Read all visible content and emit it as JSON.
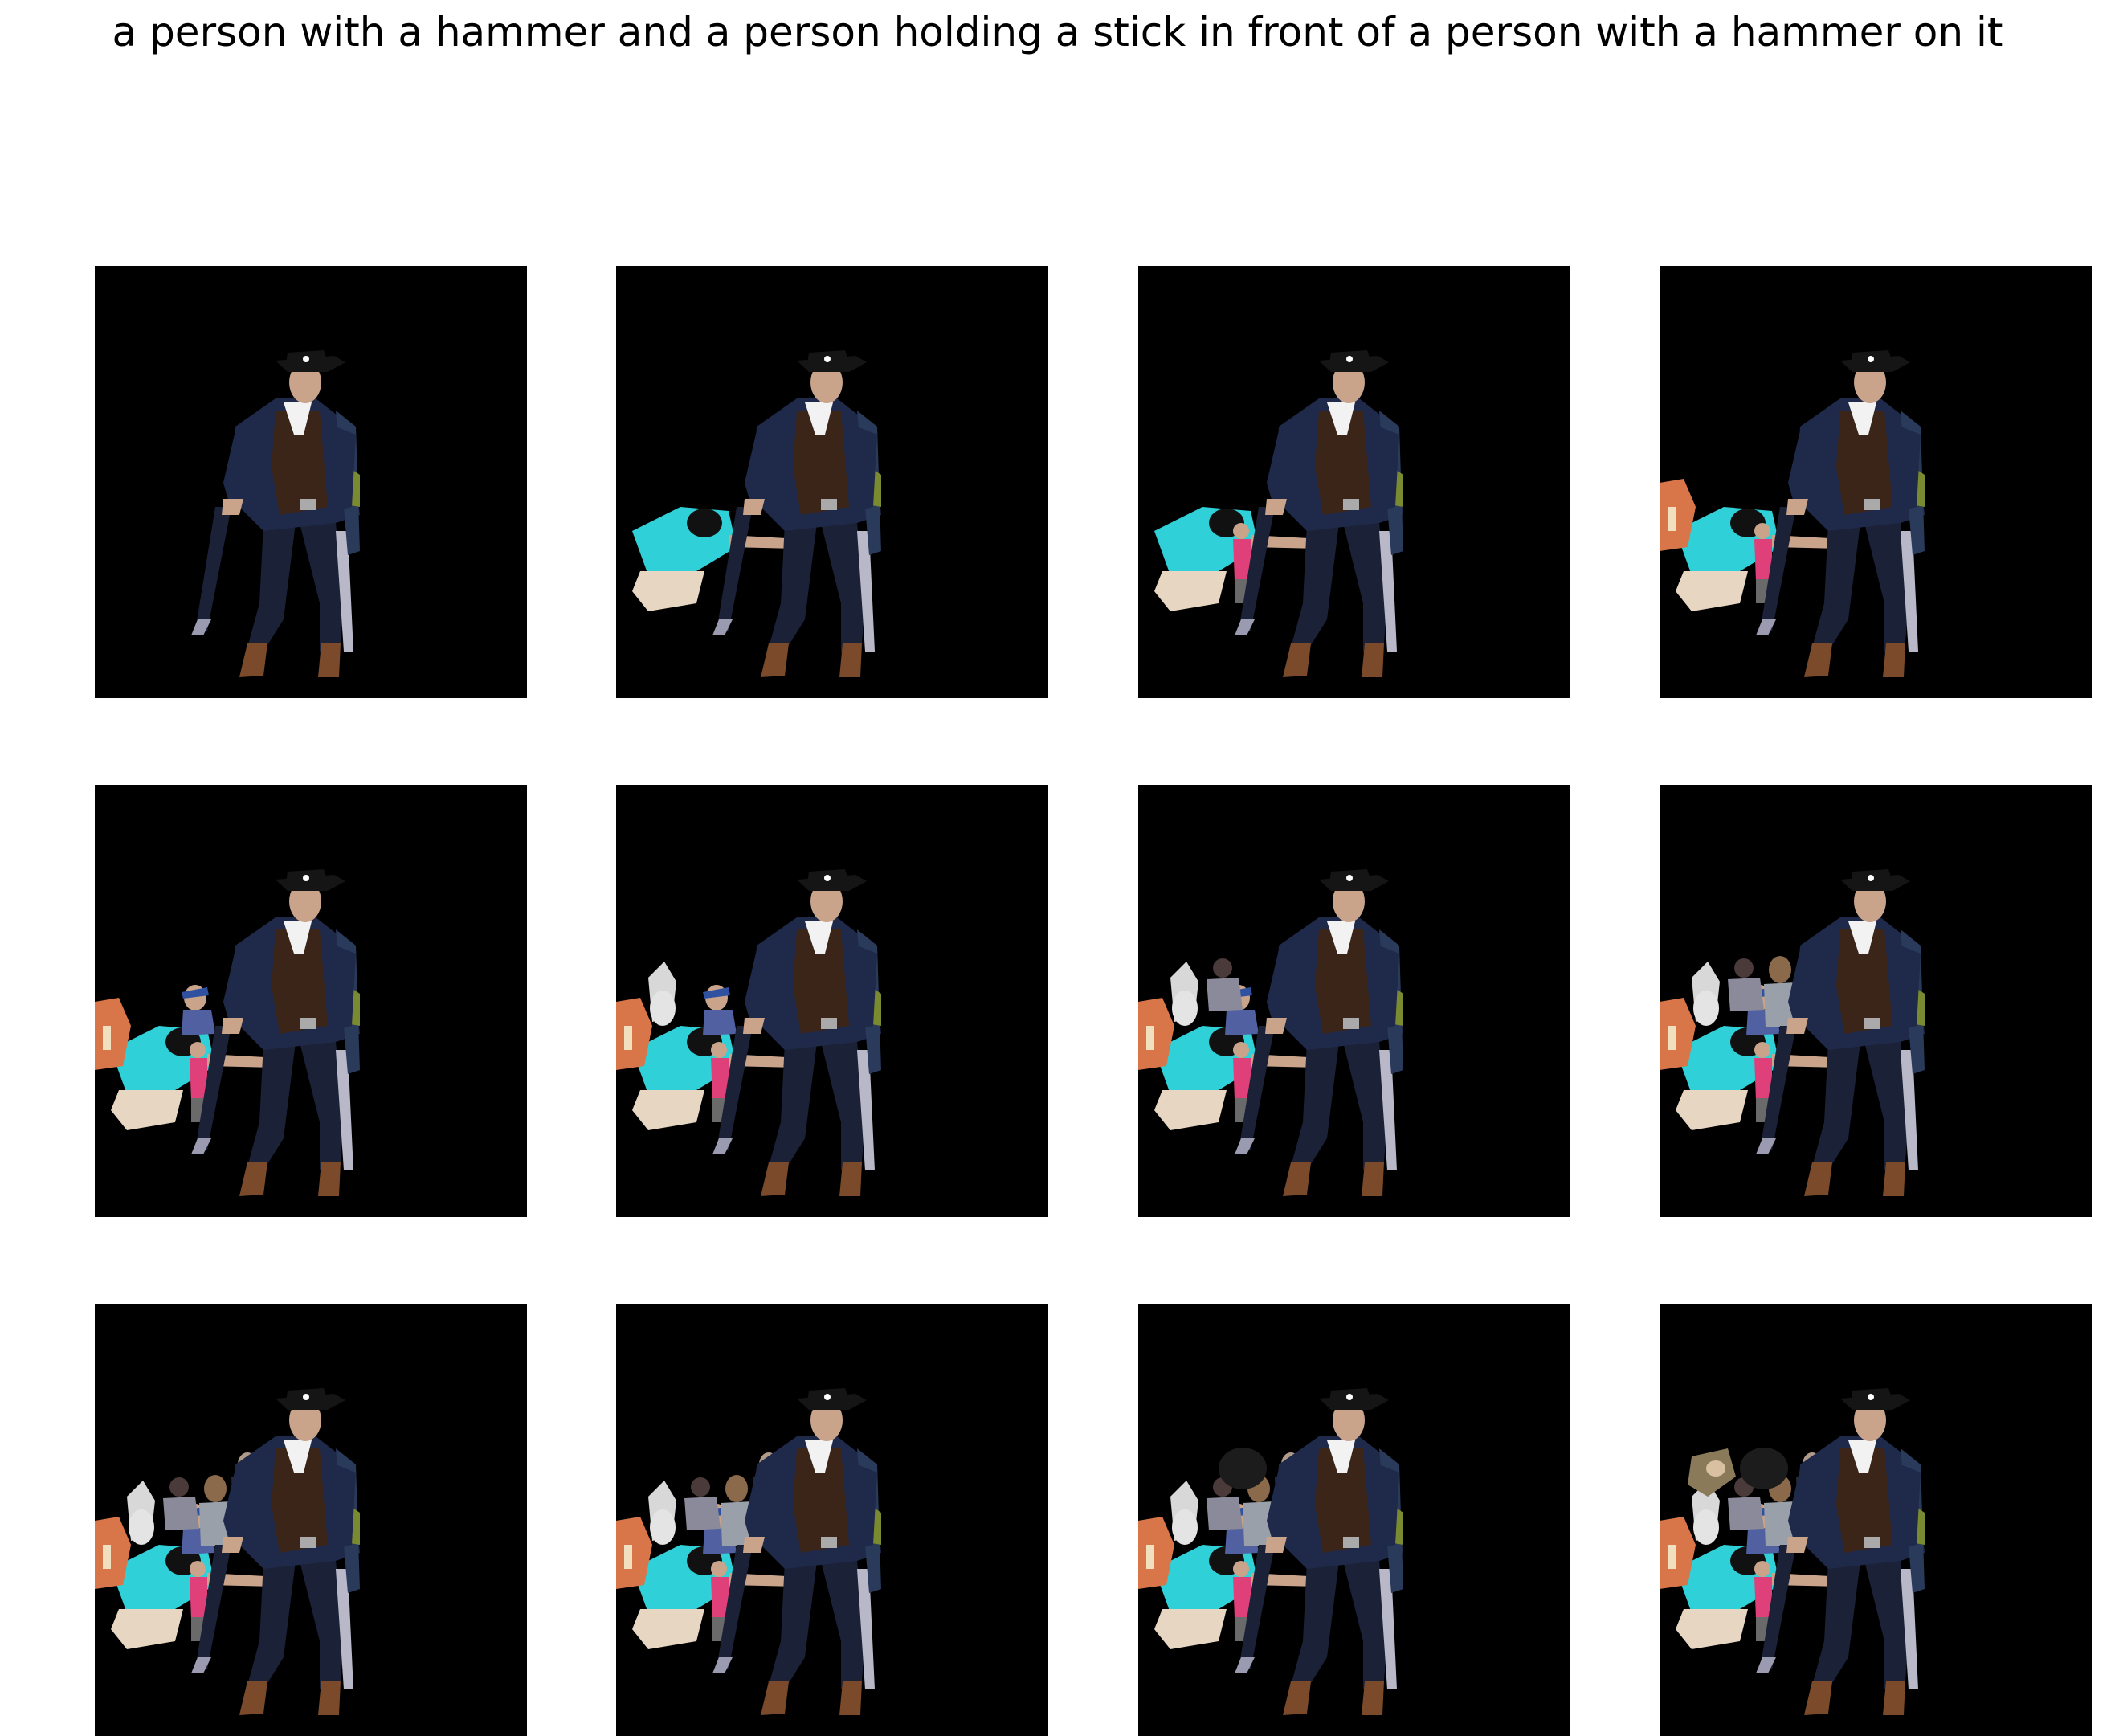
{
  "figure": {
    "title": "a person with a hammer and a person holding a stick in front of a person with a hammer on it",
    "background_color": "#ffffff",
    "panel_background": "#000000",
    "panel_count": 12,
    "grid": {
      "rows": 3,
      "cols": 4
    },
    "panels": [
      {
        "step": 1,
        "extra_figures": 0
      },
      {
        "step": 2,
        "extra_figures": 1
      },
      {
        "step": 3,
        "extra_figures": 2
      },
      {
        "step": 4,
        "extra_figures": 3
      },
      {
        "step": 5,
        "extra_figures": 4
      },
      {
        "step": 6,
        "extra_figures": 5
      },
      {
        "step": 7,
        "extra_figures": 6
      },
      {
        "step": 8,
        "extra_figures": 7
      },
      {
        "step": 9,
        "extra_figures": 8
      },
      {
        "step": 10,
        "extra_figures": 9
      },
      {
        "step": 11,
        "extra_figures": 10
      },
      {
        "step": 12,
        "extra_figures": 11
      }
    ],
    "palette": {
      "coat": "#1f2a4a",
      "vest": "#3b2418",
      "shirt": "#f2f2f2",
      "skin": "#c9a48a",
      "trousers": "#1b2238",
      "boots": "#7a4a2a",
      "hat": "#151515",
      "cyan_shirt": "#2fd0d8",
      "statue": "#d8d8d8",
      "pink": "#e0407a",
      "orange_hand": "#d8764a",
      "gray": "#8a8a9a"
    }
  }
}
